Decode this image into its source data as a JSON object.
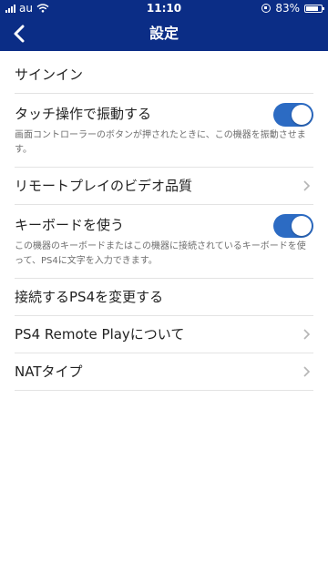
{
  "status": {
    "carrier": "au",
    "time": "11:10",
    "battery": "83%",
    "battery_level": 0.83
  },
  "header": {
    "title": "設定"
  },
  "settings": {
    "sign_in": "サインイン",
    "vibration": {
      "label": "タッチ操作で振動する",
      "description": "画面コントローラーのボタンが押されたときに、この機器を振動させます。",
      "enabled": true
    },
    "video_quality": "リモートプレイのビデオ品質",
    "keyboard": {
      "label": "キーボードを使う",
      "description": "この機器のキーボードまたはこの機器に接続されているキーボードを使って、PS4に文字を入力できます。",
      "enabled": true
    },
    "change_ps4": "接続するPS4を変更する",
    "about": "PS4 Remote Playについて",
    "nat_type": "NATタイプ"
  },
  "colors": {
    "header_bg": "#0b2d86",
    "toggle_on": "#2c6bc3"
  }
}
